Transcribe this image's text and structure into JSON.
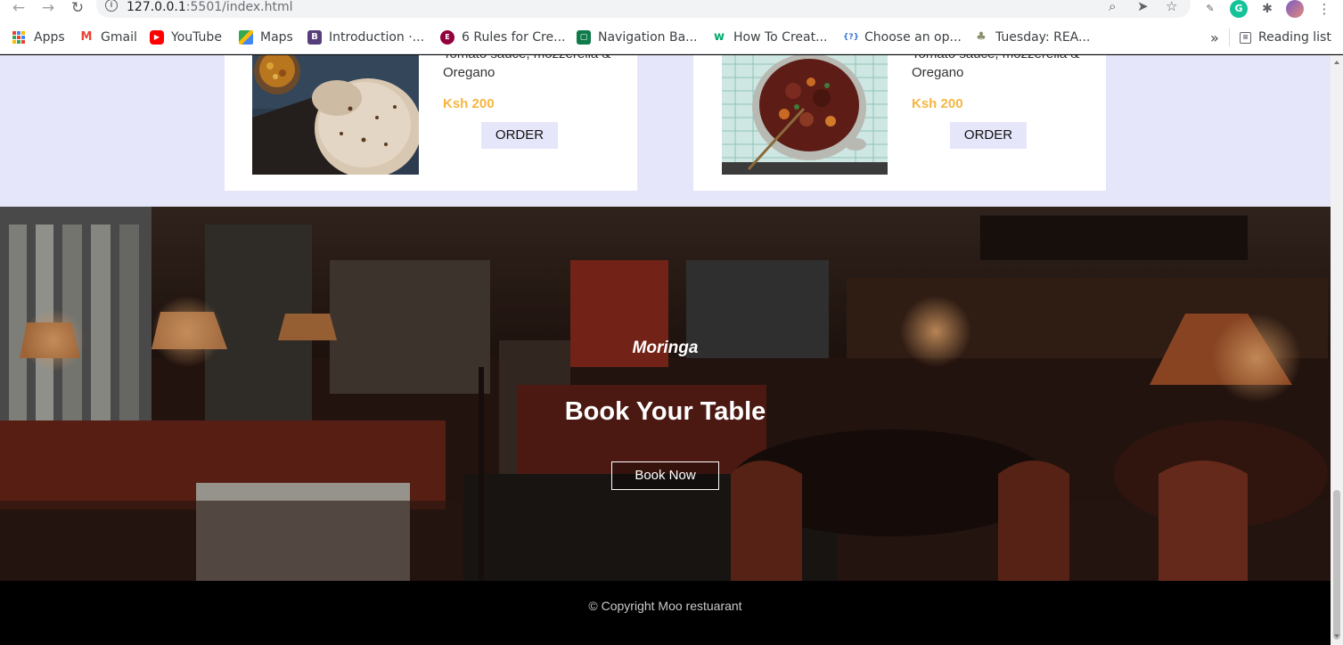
{
  "browser": {
    "url_host": "127.0.0.1",
    "url_rest": ":5501/index.html",
    "bookmarks": [
      {
        "label": "Apps",
        "icon": "apps-grid-icon"
      },
      {
        "label": "Gmail",
        "icon": "gmail-icon"
      },
      {
        "label": "YouTube",
        "icon": "youtube-icon"
      },
      {
        "label": "Maps",
        "icon": "maps-icon"
      },
      {
        "label": "Introduction ·...",
        "icon": "bootstrap-icon"
      },
      {
        "label": "6 Rules for Cre...",
        "icon": "elementor-icon"
      },
      {
        "label": "Navigation Ba...",
        "icon": "bookmark-icon"
      },
      {
        "label": "How To Creat...",
        "icon": "w3-icon"
      },
      {
        "label": "Choose an op...",
        "icon": "code-brackets-icon"
      },
      {
        "label": "Tuesday: REA...",
        "icon": "tree-icon"
      }
    ],
    "overflow_label": "»",
    "reading_list": "Reading list"
  },
  "menu": {
    "cards": [
      {
        "desc_line1": "Tomato sauce, mozzerella &",
        "desc_line2": "Oregano",
        "price": "Ksh 200",
        "order_label": "ORDER"
      },
      {
        "desc_line1": "Tomato sauce, mozzerella &",
        "desc_line2": "Oregano",
        "price": "Ksh 200",
        "order_label": "ORDER"
      }
    ]
  },
  "booking": {
    "kicker": "Moringa",
    "title": "Book Your Table",
    "button_label": "Book Now"
  },
  "footer": {
    "copyright": "© Copyright Moo restuarant"
  },
  "colors": {
    "menu_bg": "#e6e6fa",
    "price": "#f5b640",
    "footer_bg": "#000000"
  }
}
